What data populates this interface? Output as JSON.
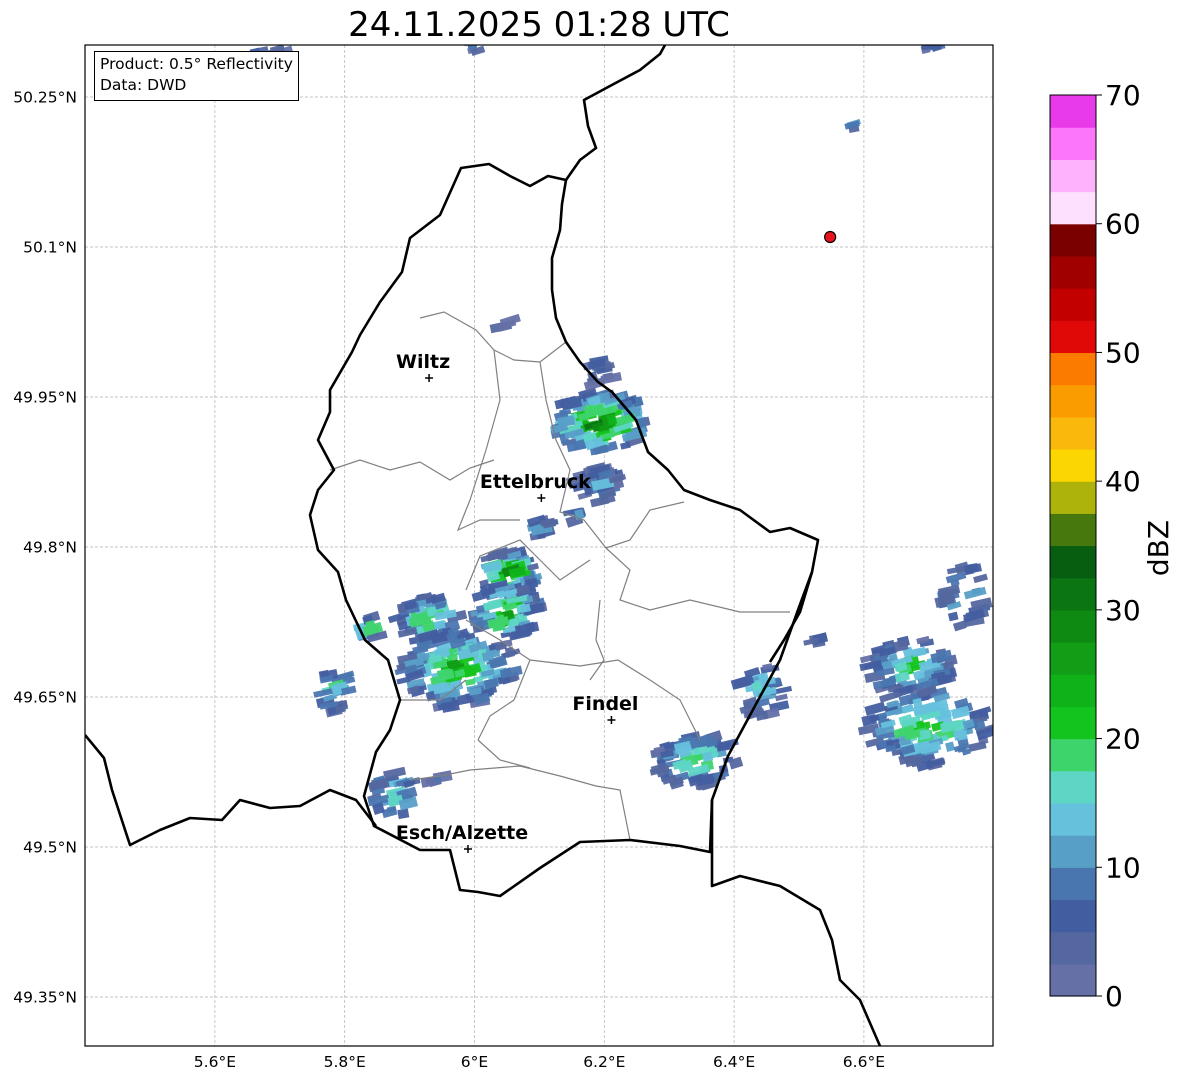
{
  "map": {
    "title": "24.11.2025 01:28 UTC",
    "info": {
      "product_line": "Product: 0.5° Reflectivity",
      "data_line": "Data: DWD"
    },
    "longitude_ticks": [
      {
        "value": 5.6,
        "label": "5.6°E"
      },
      {
        "value": 5.8,
        "label": "5.8°E"
      },
      {
        "value": 6.0,
        "label": "6°E"
      },
      {
        "value": 6.2,
        "label": "6.2°E"
      },
      {
        "value": 6.4,
        "label": "6.4°E"
      },
      {
        "value": 6.6,
        "label": "6.6°E"
      }
    ],
    "latitude_ticks": [
      {
        "value": 50.25,
        "label": "50.25°N"
      },
      {
        "value": 50.1,
        "label": "50.1°N"
      },
      {
        "value": 49.95,
        "label": "49.95°N"
      },
      {
        "value": 49.8,
        "label": "49.8°N"
      },
      {
        "value": 49.65,
        "label": "49.65°N"
      },
      {
        "value": 49.5,
        "label": "49.5°N"
      },
      {
        "value": 49.35,
        "label": "49.35°N"
      }
    ],
    "cities": [
      {
        "name": "Wiltz",
        "lon": 5.93,
        "lat": 49.969
      },
      {
        "name": "Ettelbruck",
        "lon": 6.103,
        "lat": 49.849
      },
      {
        "name": "Findel",
        "lon": 6.211,
        "lat": 49.627
      },
      {
        "name": "Esch/Alzette",
        "lon": 5.99,
        "lat": 49.498
      }
    ],
    "radar_site": {
      "lon": 6.548,
      "lat": 50.11,
      "color": "#e8141c"
    },
    "colorbar": {
      "label": "dBZ",
      "min": 0,
      "max": 70,
      "ticks": [
        "0",
        "10",
        "20",
        "30",
        "40",
        "50",
        "60",
        "70"
      ],
      "colors": [
        "#6470a6",
        "#54679f",
        "#435ea0",
        "#4a76b0",
        "#589fc8",
        "#66c1dd",
        "#5ed6c6",
        "#3ed46c",
        "#14c41e",
        "#10b21a",
        "#119e16",
        "#0e8a12",
        "#0b7512",
        "#075d10",
        "#46780e",
        "#aeb30c",
        "#fbd600",
        "#f9b80b",
        "#fa9c00",
        "#fb7b00",
        "#e10808",
        "#c20000",
        "#a00000",
        "#7a0000",
        "#fde0fd",
        "#fdb2fd",
        "#fb76fb",
        "#e93ae9"
      ]
    }
  }
}
